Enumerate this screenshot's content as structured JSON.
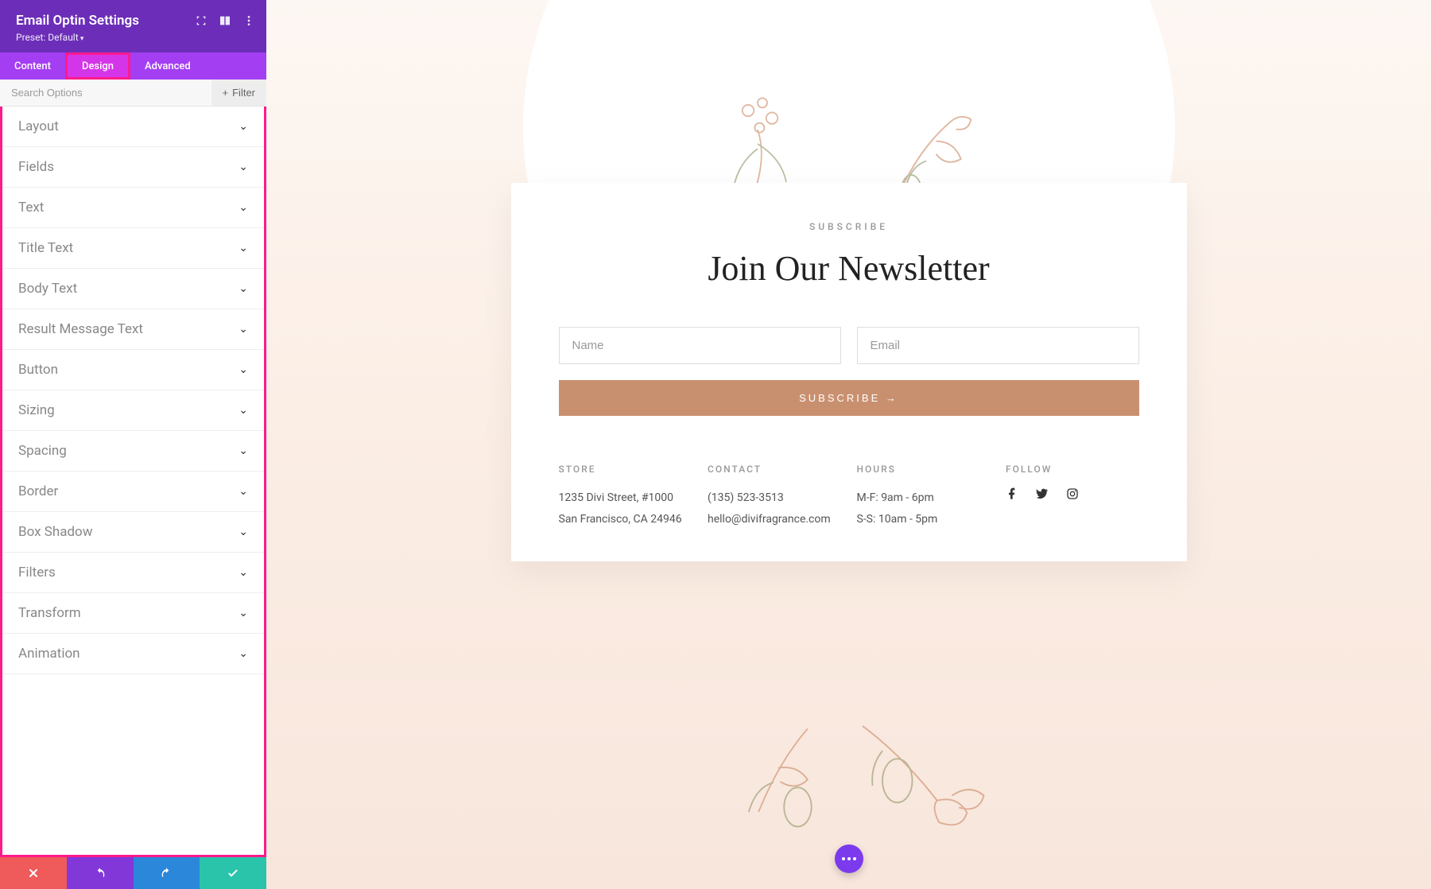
{
  "panel": {
    "title": "Email Optin Settings",
    "preset": "Preset: Default",
    "tabs": [
      "Content",
      "Design",
      "Advanced"
    ],
    "active_tab": "Design",
    "search_placeholder": "Search Options",
    "filter_label": "Filter",
    "sections": [
      "Layout",
      "Fields",
      "Text",
      "Title Text",
      "Body Text",
      "Result Message Text",
      "Button",
      "Sizing",
      "Spacing",
      "Border",
      "Box Shadow",
      "Filters",
      "Transform",
      "Animation"
    ]
  },
  "preview": {
    "subscribe_label": "SUBSCRIBE",
    "title": "Join Our Newsletter",
    "name_placeholder": "Name",
    "email_placeholder": "Email",
    "button_label": "SUBSCRIBE →",
    "footer": {
      "store": {
        "head": "STORE",
        "line1": "1235 Divi Street, #1000",
        "line2": "San Francisco, CA 24946"
      },
      "contact": {
        "head": "CONTACT",
        "line1": "(135) 523-3513",
        "line2": "hello@divifragrance.com"
      },
      "hours": {
        "head": "HOURS",
        "line1": "M-F: 9am - 6pm",
        "line2": "S-S: 10am - 5pm"
      },
      "follow": {
        "head": "FOLLOW"
      }
    }
  }
}
